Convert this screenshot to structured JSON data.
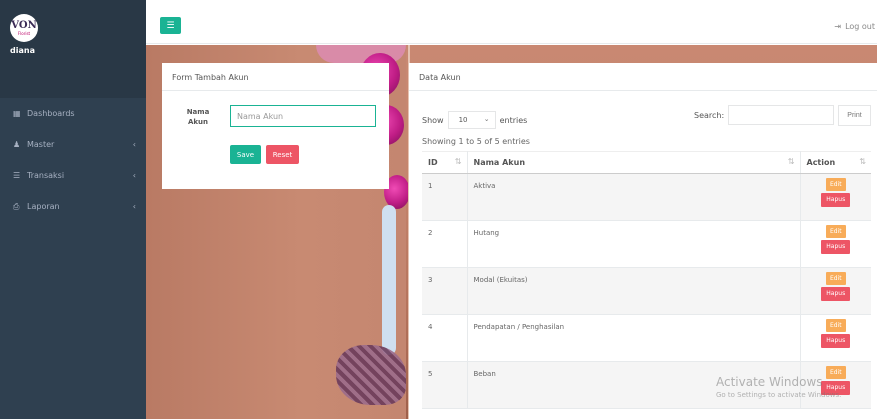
{
  "sidebar": {
    "logo_text": "VON",
    "logo_sub": "Florist",
    "user_name": "diana",
    "items": [
      {
        "label": "Dashboards",
        "icon": "th-large-icon",
        "has_children": false
      },
      {
        "label": "Master",
        "icon": "users-icon",
        "has_children": true
      },
      {
        "label": "Transaksi",
        "icon": "cart-icon",
        "has_children": true
      },
      {
        "label": "Laporan",
        "icon": "print-icon",
        "has_children": true
      }
    ]
  },
  "topbar": {
    "logout_label": "Log out"
  },
  "form": {
    "title": "Form Tambah Akun",
    "field_label": "Nama Akun",
    "field_placeholder": "Nama Akun",
    "field_value": "",
    "save_label": "Save",
    "reset_label": "Reset"
  },
  "table": {
    "title": "Data Akun",
    "show_label": "Show",
    "entries_value": "10",
    "entries_label": "entries",
    "search_label": "Search:",
    "print_label": "Print",
    "info": "Showing 1 to 5 of 5 entries",
    "columns": [
      "ID",
      "Nama Akun",
      "Action"
    ],
    "edit_label": "Edit",
    "delete_label": "Hapus",
    "rows": [
      {
        "id": "1",
        "name": "Aktiva"
      },
      {
        "id": "2",
        "name": "Hutang"
      },
      {
        "id": "3",
        "name": "Modal (Ekuitas)"
      },
      {
        "id": "4",
        "name": "Pendapatan / Penghasilan"
      },
      {
        "id": "5",
        "name": "Beban"
      }
    ]
  },
  "watermark": {
    "line1": "Activate Windows",
    "line2": "Go to Settings to activate Windows."
  },
  "colors": {
    "primary": "#1ab394",
    "danger": "#ed5565",
    "warning": "#f8ac59",
    "sidebar": "#2f4050"
  }
}
